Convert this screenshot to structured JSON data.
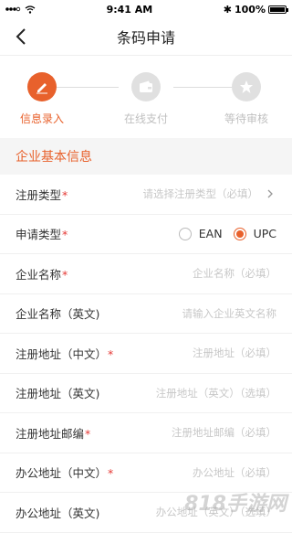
{
  "status_bar": {
    "time": "9:41 AM",
    "battery": "100%"
  },
  "nav": {
    "title": "条码申请"
  },
  "steps": [
    {
      "label": "信息录入",
      "active": true,
      "icon": "pencil-icon"
    },
    {
      "label": "在线支付",
      "active": false,
      "icon": "wallet-icon"
    },
    {
      "label": "等待审核",
      "active": false,
      "icon": "star-icon"
    }
  ],
  "section": {
    "title": "企业基本信息"
  },
  "form": {
    "reg_type": {
      "label": "注册类型",
      "required": "*",
      "placeholder": "请选择注册类型（必填）"
    },
    "apply_type": {
      "label": "申请类型",
      "required": "*",
      "options": [
        "EAN",
        "UPC"
      ],
      "selected": "UPC"
    },
    "company_name": {
      "label": "企业名称",
      "required": "*",
      "placeholder": "企业名称（必填）"
    },
    "company_name_en": {
      "label": "企业名称（英文)",
      "placeholder": "请输入企业英文名称"
    },
    "reg_address_cn": {
      "label": "注册地址（中文）",
      "required": "*",
      "placeholder": "注册地址（必填）"
    },
    "reg_address_en": {
      "label": "注册地址（英文)",
      "placeholder": "注册地址（英文）（选填）"
    },
    "reg_postcode": {
      "label": "注册地址邮编",
      "required": "*",
      "placeholder": "注册地址邮编（必填）"
    },
    "office_address_cn": {
      "label": "办公地址（中文）",
      "required": "*",
      "placeholder": "办公地址（必填）"
    },
    "office_address_en": {
      "label": "办公地址（英文)",
      "placeholder": "办公地址（英文）（选填）"
    }
  },
  "watermark": "818手游网",
  "colors": {
    "accent": "#e8612c",
    "required": "#e53935",
    "inactive_step": "#e0e0e0"
  }
}
